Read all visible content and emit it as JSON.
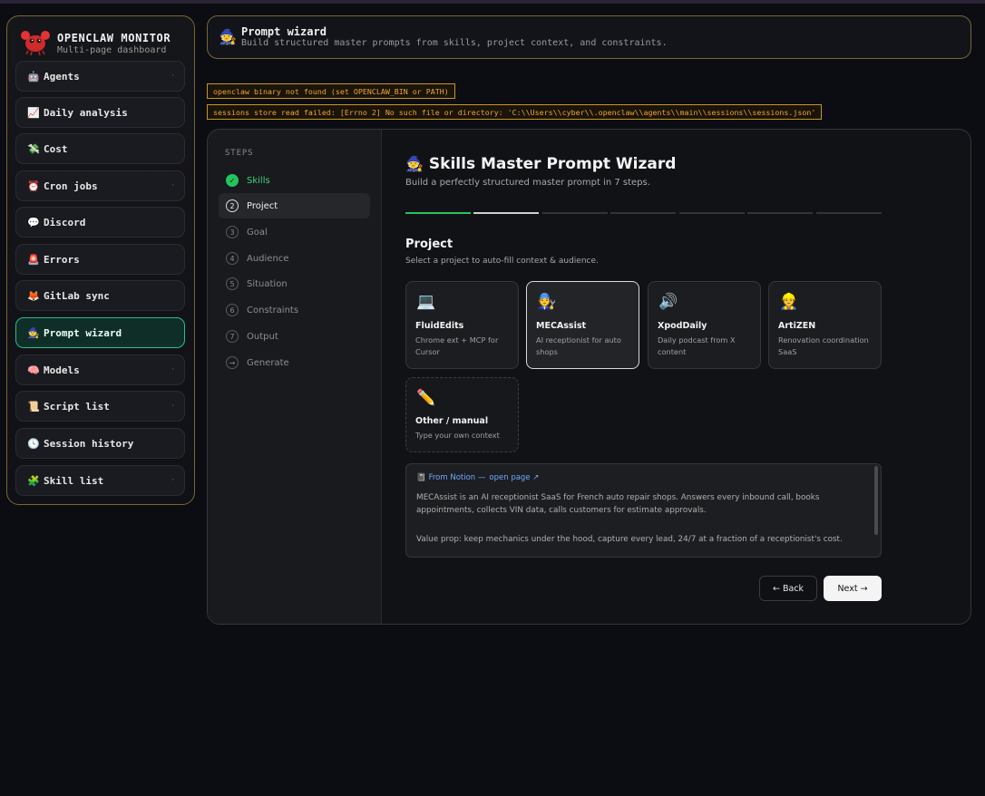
{
  "app": {
    "title": "OPENCLAW MONITOR",
    "subtitle": "Multi-page dashboard"
  },
  "sidebar": {
    "items": [
      {
        "label": "Agents",
        "icon": "🤖",
        "chevron": "·"
      },
      {
        "label": "Daily analysis",
        "icon": "📈",
        "chevron": ""
      },
      {
        "label": "Cost",
        "icon": "💸",
        "chevron": ""
      },
      {
        "label": "Cron jobs",
        "icon": "⏰",
        "chevron": "·"
      },
      {
        "label": "Discord",
        "icon": "💬",
        "chevron": ""
      },
      {
        "label": "Errors",
        "icon": "🚨",
        "chevron": ""
      },
      {
        "label": "GitLab sync",
        "icon": "🦊",
        "chevron": ""
      },
      {
        "label": "Prompt wizard",
        "icon": "🧙",
        "chevron": ""
      },
      {
        "label": "Models",
        "icon": "🧠",
        "chevron": "·"
      },
      {
        "label": "Script list",
        "icon": "📜",
        "chevron": "·"
      },
      {
        "label": "Session history",
        "icon": "🕓",
        "chevron": ""
      },
      {
        "label": "Skill list",
        "icon": "🧩",
        "chevron": "·"
      }
    ],
    "active_index": 7
  },
  "header": {
    "icon": "🧙",
    "title": "Prompt wizard",
    "subtitle": "Build structured master prompts from skills, project context, and constraints."
  },
  "warnings": [
    "openclaw binary not found (set OPENCLAW_BIN or PATH)",
    "sessions store read failed: [Errno 2] No such file or directory: 'C:\\\\Users\\\\cyber\\\\.openclaw\\\\agents\\\\main\\\\sessions\\\\sessions.json'"
  ],
  "steps": {
    "heading": "STEPS",
    "items": [
      {
        "num": "✓",
        "label": "Skills",
        "state": "done"
      },
      {
        "num": "2",
        "label": "Project",
        "state": "current"
      },
      {
        "num": "3",
        "label": "Goal",
        "state": "todo"
      },
      {
        "num": "4",
        "label": "Audience",
        "state": "todo"
      },
      {
        "num": "5",
        "label": "Situation",
        "state": "todo"
      },
      {
        "num": "6",
        "label": "Constraints",
        "state": "todo"
      },
      {
        "num": "7",
        "label": "Output",
        "state": "todo"
      },
      {
        "num": "→",
        "label": "Generate",
        "state": "todo"
      }
    ]
  },
  "wizard": {
    "icon": "🧙",
    "title": "Skills Master Prompt Wizard",
    "subtitle": "Build a perfectly structured master prompt in 7 steps.",
    "progress": {
      "total": 7,
      "done": 1,
      "current": 2
    }
  },
  "project": {
    "title": "Project",
    "subtitle": "Select a project to auto-fill context & audience.",
    "cards": [
      {
        "icon": "💻",
        "name": "FluidEdits",
        "desc": "Chrome ext + MCP for Cursor",
        "selected": false
      },
      {
        "icon": "🧑‍🔧",
        "name": "MECAssist",
        "desc": "AI receptionist for auto shops",
        "selected": true
      },
      {
        "icon": "🔊",
        "name": "XpodDaily",
        "desc": "Daily podcast from X content",
        "selected": false
      },
      {
        "icon": "👷",
        "name": "ArtiZEN",
        "desc": "Renovation coordination SaaS",
        "selected": false
      },
      {
        "icon": "✏️",
        "name": "Other / manual",
        "desc": "Type your own context",
        "selected": false
      }
    ]
  },
  "notion": {
    "icon": "📓",
    "source": "From Notion —",
    "link": "open page ↗",
    "paragraphs": [
      "MECAssist is an AI receptionist SaaS for French auto repair shops. Answers every inbound call, books appointments, collects VIN data, calls customers for estimate approvals.",
      "Value prop: keep mechanics under the hood, capture every lead, 24/7 at a fraction of a receptionist's cost."
    ]
  },
  "buttons": {
    "back": "← Back",
    "next": "Next →"
  },
  "colors": {
    "accent_green": "#22c55e",
    "active_nav_border": "#25c08a",
    "gold_border": "#7a6630",
    "warning": "#f0a536",
    "link": "#6fa9ff"
  }
}
